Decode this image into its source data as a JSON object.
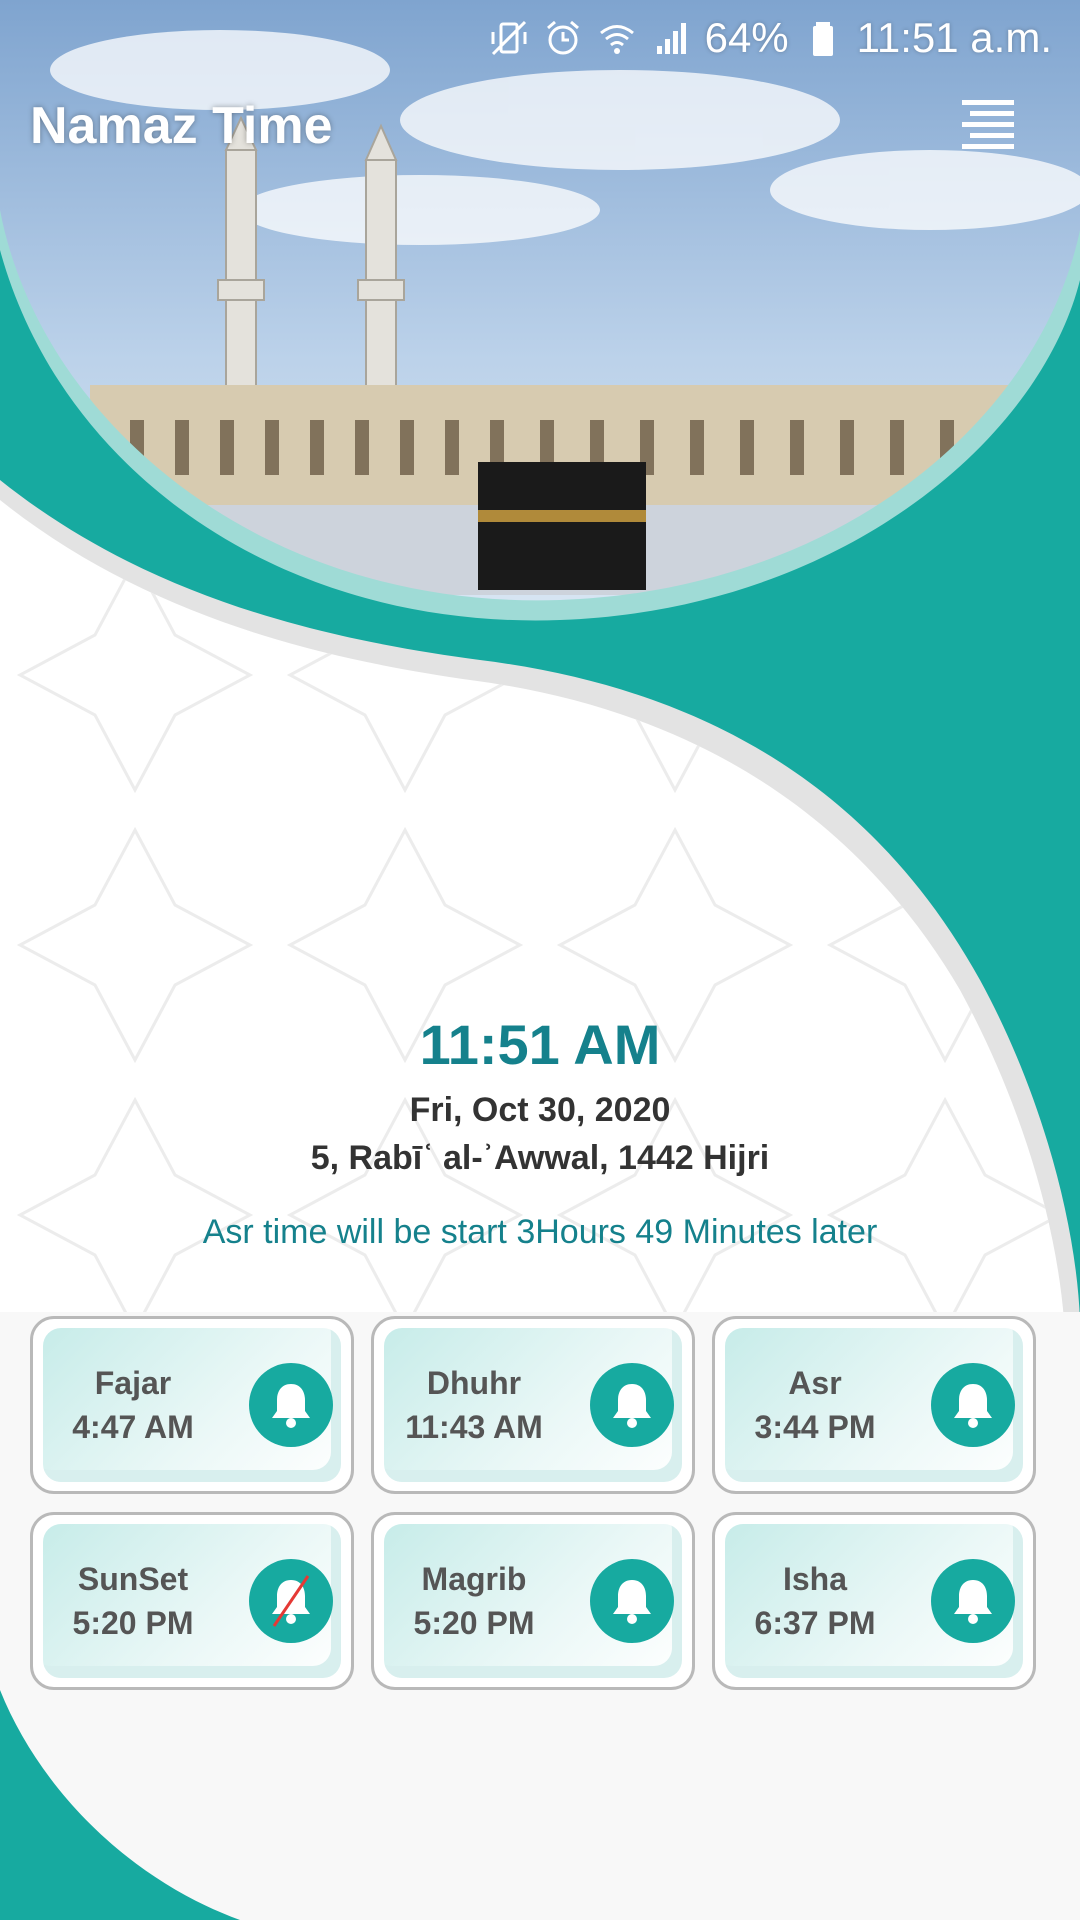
{
  "colors": {
    "teal": "#17aaa0",
    "teal_dark": "#15818c",
    "teal_light": "#9fdbd6",
    "text_dark": "#333333",
    "text_gray": "#555555"
  },
  "status_bar": {
    "icons": [
      "mute-vibrate-icon",
      "alarm-icon",
      "wifi-icon",
      "signal-icon",
      "battery-icon"
    ],
    "battery": "64%",
    "time": "11:51 a.m."
  },
  "header": {
    "title": "Namaz Time",
    "menu_icon": "menu-icon"
  },
  "clock": {
    "time": "11:51 AM",
    "date": "Fri, Oct 30, 2020",
    "hijri": "5, Rabīʿ al-ʾAwwal, 1442 Hijri"
  },
  "next_prayer_message": "Asr time will be start 3Hours 49 Minutes later",
  "prayers": [
    {
      "name": "Fajar",
      "time": "4:47 AM",
      "alarm": "bell-icon"
    },
    {
      "name": "Dhuhr",
      "time": "11:43 AM",
      "alarm": "bell-icon"
    },
    {
      "name": "Asr",
      "time": "3:44 PM",
      "alarm": "bell-icon"
    },
    {
      "name": "SunSet",
      "time": "5:20 PM",
      "alarm": "bell-off-icon"
    },
    {
      "name": "Magrib",
      "time": "5:20 PM",
      "alarm": "bell-icon"
    },
    {
      "name": "Isha",
      "time": "6:37 PM",
      "alarm": "bell-icon"
    }
  ]
}
